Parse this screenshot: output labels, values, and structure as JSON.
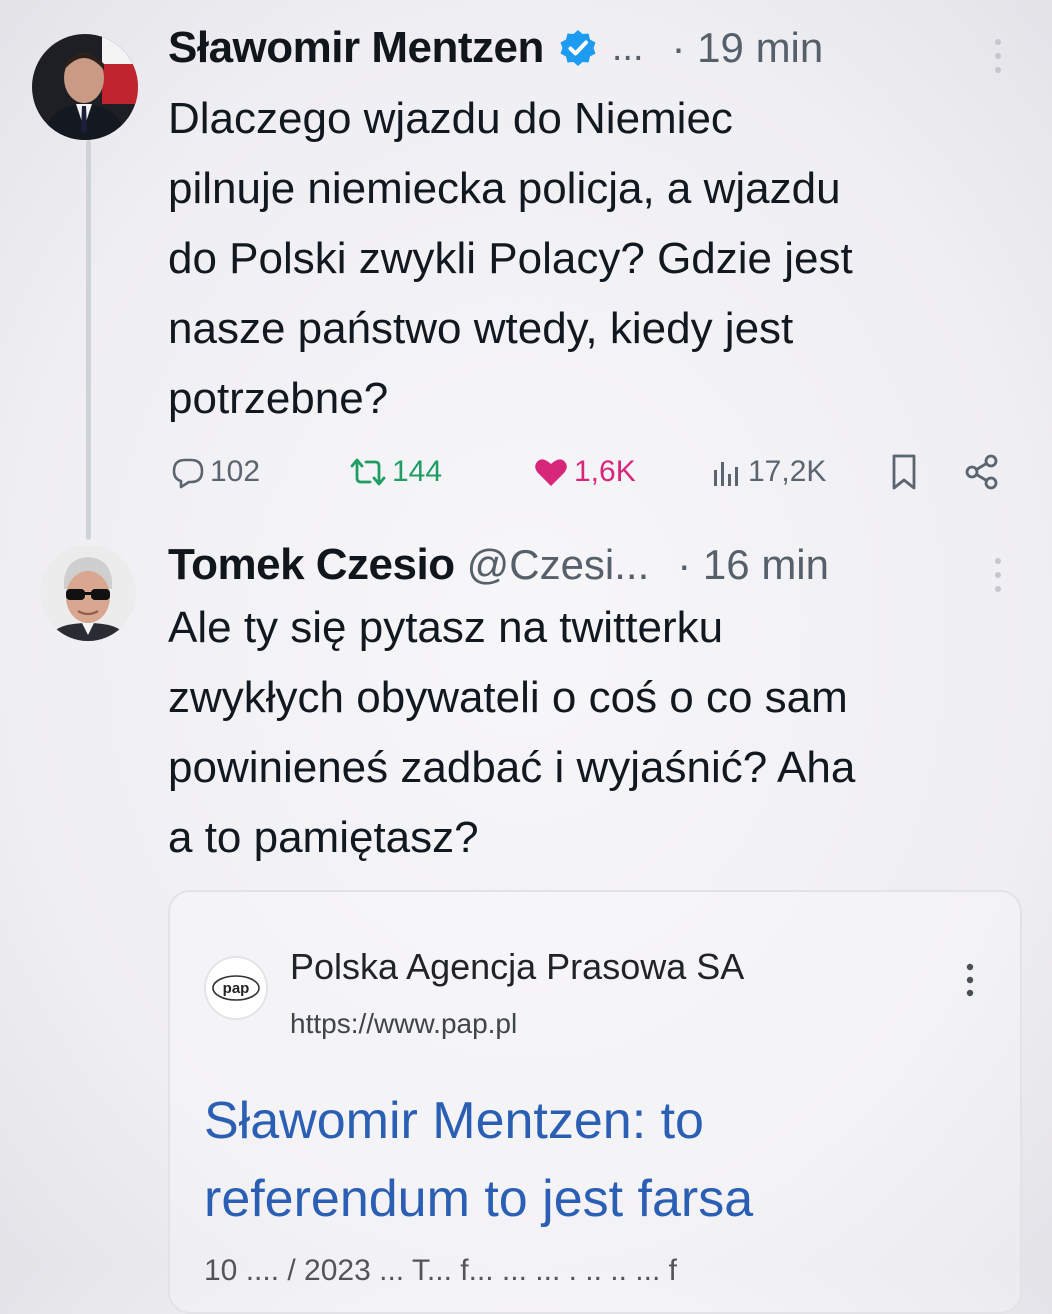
{
  "tweets": [
    {
      "author_name": "Sławomir Mentzen",
      "verified": true,
      "name_suffix": "...",
      "time": "· 19 min",
      "text": "Dlaczego wjazdu do Niemiec\npilnuje niemiecka policja, a wjazdu\ndo Polski zwykli Polacy? Gdzie jest\nnasze państwo wtedy, kiedy jest\npotrzebne?",
      "stats": {
        "replies": "102",
        "retweets": "144",
        "likes": "1,6K",
        "views": "17,2K"
      }
    },
    {
      "author_name": "Tomek Czesio",
      "handle": "@Czesi...",
      "time": "· 16 min",
      "text": "Ale ty się pytasz na twitterku\nzwykłych obywateli o coś o co sam\npowinieneś zadbać i wyjaśnić? Aha\na to pamiętasz?"
    }
  ],
  "card": {
    "logo_text": "pap",
    "site_name": "Polska Agencja Prasowa SA",
    "url": "https://www.pap.pl",
    "title": "Sławomir Mentzen: to\nreferendum to jest farsa",
    "snippet_partial": "10 .... / 2023 ... T... f... ... ... . .. .. ... f"
  },
  "colors": {
    "verified_blue": "#1d9bf0",
    "retweet_green": "#1e9e64",
    "like_pink": "#d6277a",
    "link_blue": "#2b5fb4",
    "muted_gray": "#55606b"
  },
  "icons": {
    "reply": "speech-bubble-icon",
    "retweet": "retweet-arrows-icon",
    "like": "heart-icon",
    "views": "bar-chart-icon",
    "bookmark": "bookmark-icon",
    "share": "share-nodes-icon",
    "more": "vertical-dots-icon"
  }
}
